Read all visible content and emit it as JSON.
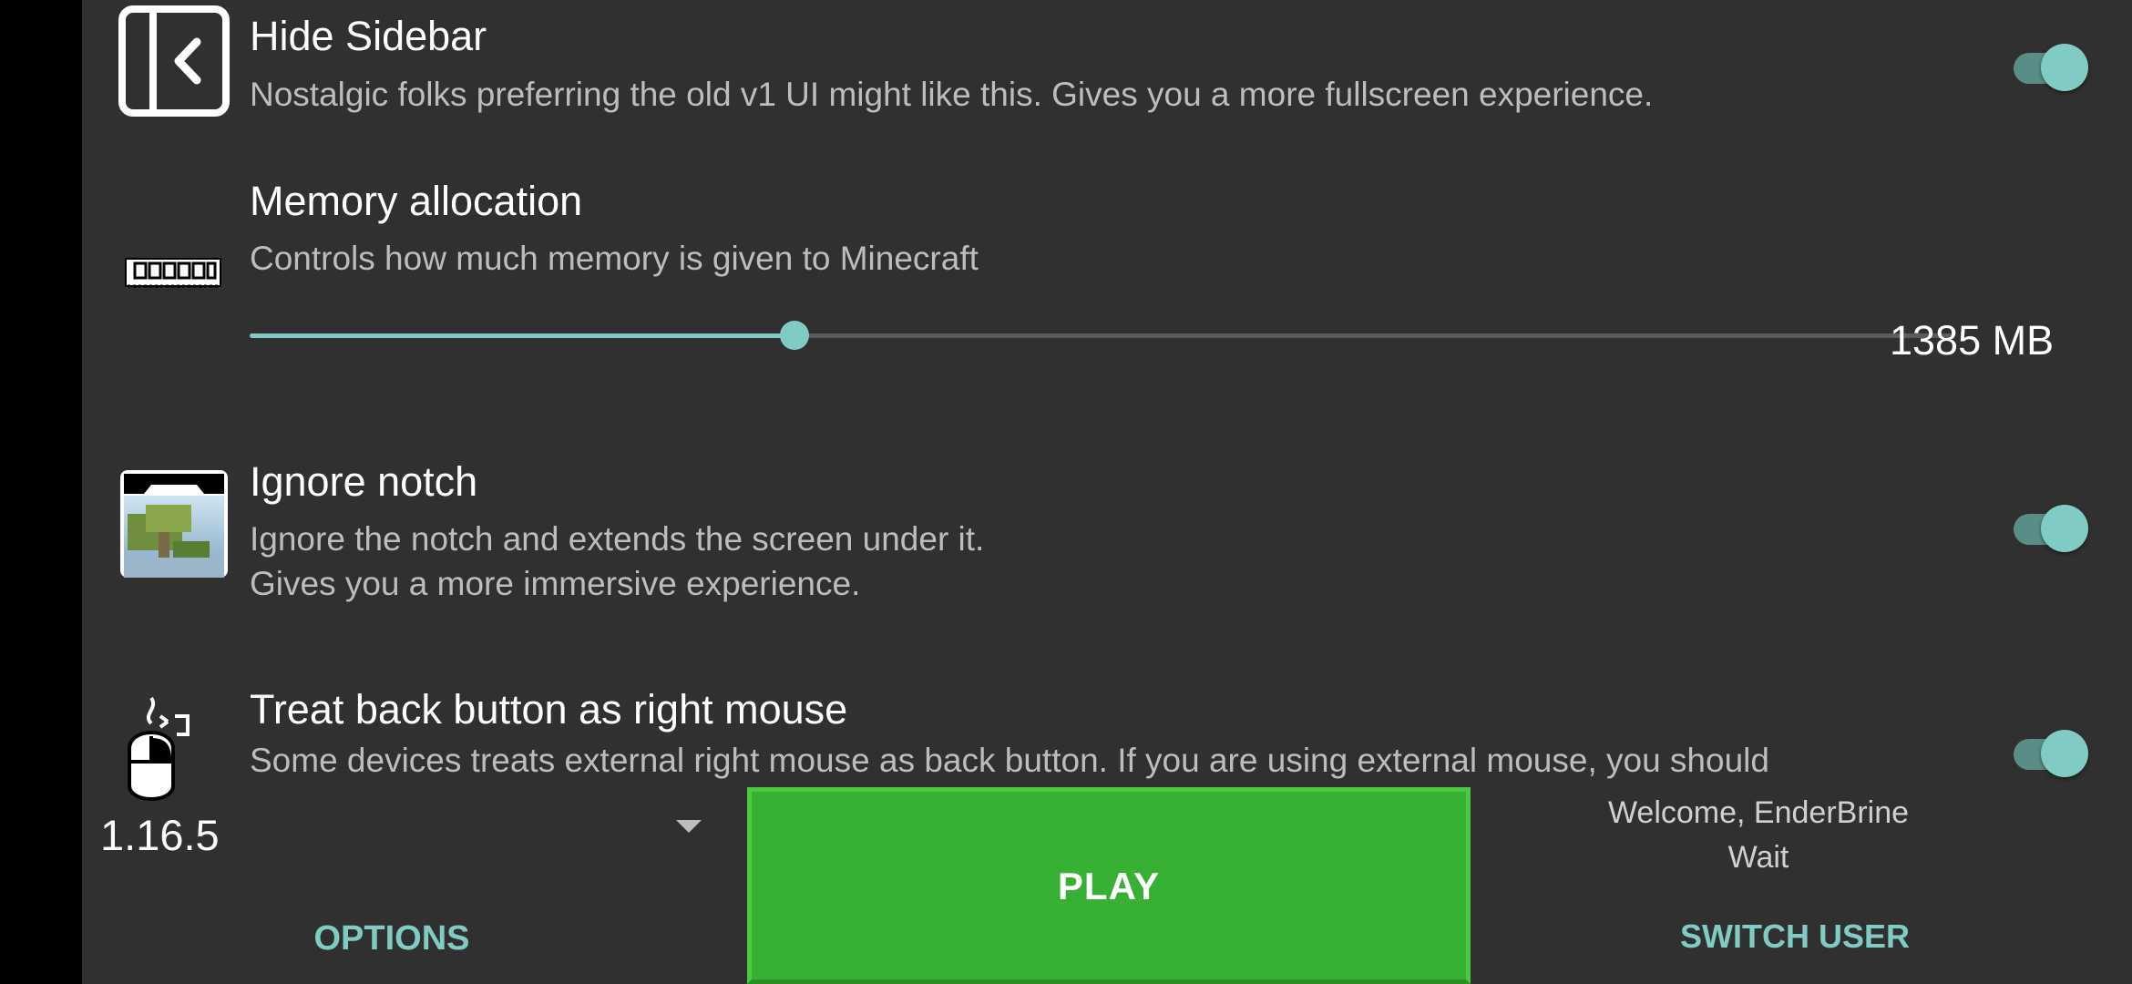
{
  "settings": {
    "hide_sidebar": {
      "title": "Hide Sidebar",
      "description": "Nostalgic folks preferring the old v1 UI might like this. Gives you a more fullscreen experience.",
      "enabled": true,
      "icon": "sidebar-collapse-icon"
    },
    "memory": {
      "title": "Memory allocation",
      "description": "Controls how much memory is given to Minecraft",
      "value_label": "1385 MB",
      "slider_fraction": 0.32,
      "icon": "ram-stick-icon"
    },
    "ignore_notch": {
      "title": "Ignore notch",
      "description_line1": "Ignore the notch and extends the screen under it.",
      "description_line2": "Gives you a more immersive experience.",
      "enabled": true,
      "icon": "notch-screen-icon"
    },
    "back_button": {
      "title": "Treat back button as right mouse",
      "description": "Some devices treats external right mouse as back button. If you are using external mouse, you should",
      "enabled": true,
      "icon": "mouse-icon"
    }
  },
  "bottom_bar": {
    "version": "1.16.5",
    "options_label": "OPTIONS",
    "play_label": "PLAY",
    "welcome_text": "Welcome, EnderBrine",
    "status_text": "Wait",
    "switch_user_label": "SWITCH USER"
  },
  "colors": {
    "background": "#303030",
    "accent": "#80cbc4",
    "play_button": "#37b034"
  }
}
